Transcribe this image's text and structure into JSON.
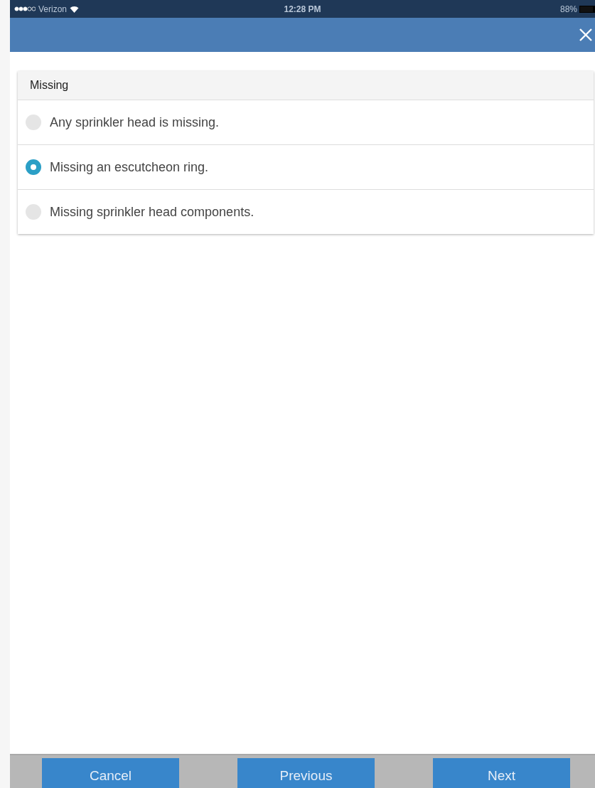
{
  "status_bar": {
    "carrier": "Verizon",
    "time": "12:28 PM",
    "battery": "88%"
  },
  "group": {
    "title": "Missing",
    "options": [
      {
        "label": "Any sprinkler head is missing.",
        "selected": false
      },
      {
        "label": "Missing an escutcheon ring.",
        "selected": true
      },
      {
        "label": "Missing sprinkler head components.",
        "selected": false
      }
    ]
  },
  "buttons": [
    "Cancel",
    "Previous",
    "Next"
  ]
}
